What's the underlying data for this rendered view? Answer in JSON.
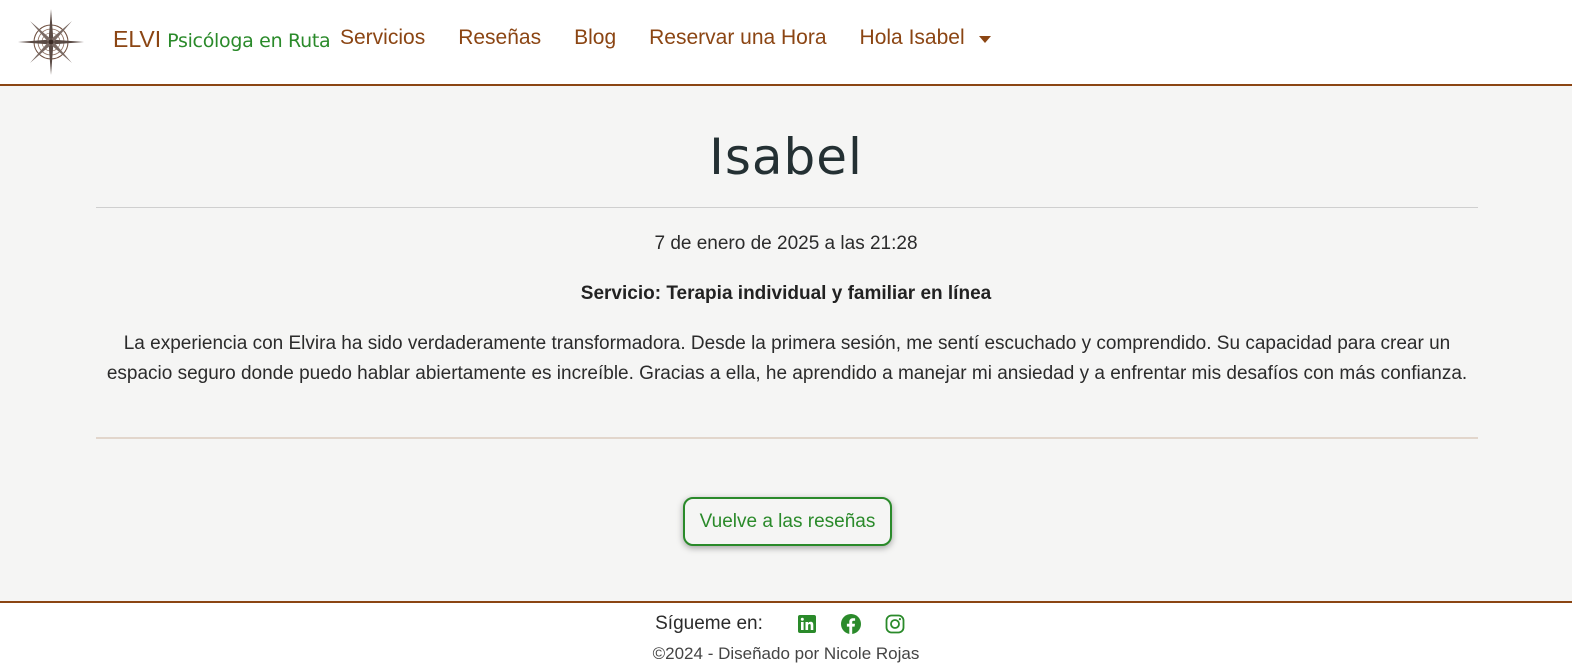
{
  "brand": {
    "name": "ELVI",
    "tagline": "Psicóloga en Ruta"
  },
  "nav": {
    "items": [
      {
        "label": "Servicios"
      },
      {
        "label": "Reseñas"
      },
      {
        "label": "Blog"
      },
      {
        "label": "Reservar una Hora"
      }
    ],
    "user_menu_label": "Hola Isabel"
  },
  "review": {
    "author": "Isabel",
    "date": "7 de enero de 2025 a las 21:28",
    "service": "Servicio: Terapia individual y familiar en línea",
    "text": "La experiencia con Elvira ha sido verdaderamente transformadora. Desde la primera sesión, me sentí escuchado y comprendido. Su capacidad para crear un espacio seguro donde puedo hablar abiertamente es increíble. Gracias a ella, he aprendido a manejar mi ansiedad y a enfrentar mis desafíos con más confianza.",
    "back_button_label": "Vuelve a las reseñas"
  },
  "footer": {
    "follow_label": "Sígueme en:",
    "social_icons": [
      "linkedin-icon",
      "facebook-icon",
      "instagram-icon"
    ],
    "copyright": "©2024 - Diseñado por Nicole Rojas"
  },
  "colors": {
    "brand_brown": "#8b4513",
    "accent_green": "#2a8a2a",
    "page_background": "#f5f5f4",
    "heading": "#243033"
  }
}
